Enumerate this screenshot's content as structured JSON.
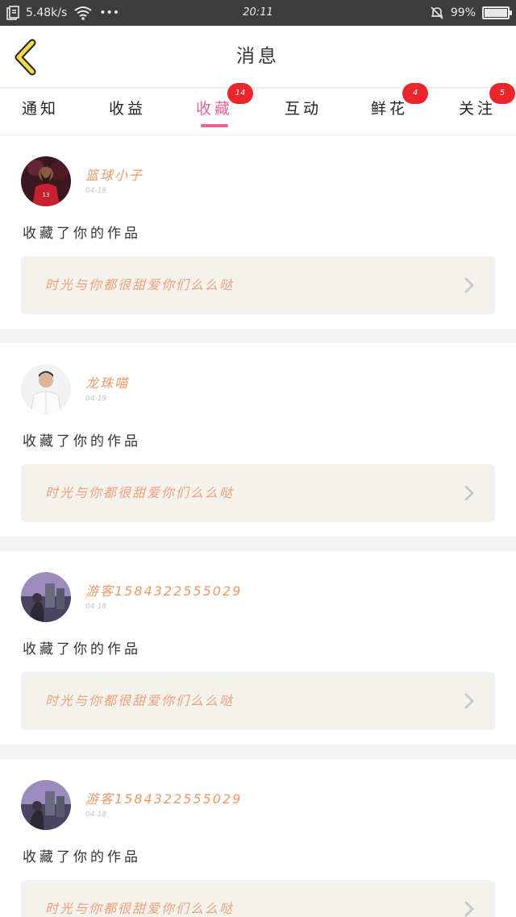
{
  "status_bar": {
    "speed": "5.48k/s",
    "more": "•••",
    "time": "20:11",
    "battery": "99%",
    "battery_level": 0.99
  },
  "nav": {
    "title": "消息"
  },
  "tabs": [
    {
      "label": "通知",
      "badge": ""
    },
    {
      "label": "收益",
      "badge": ""
    },
    {
      "label": "收藏",
      "badge": "14",
      "active": true
    },
    {
      "label": "互动",
      "badge": ""
    },
    {
      "label": "鲜花",
      "badge": "4"
    },
    {
      "label": "关注",
      "badge": "5"
    }
  ],
  "messages": [
    {
      "user": "篮球小子",
      "date": "04-19",
      "action": "收藏了你的作品",
      "work": "时光与你都很甜爱你们么么哒",
      "avatar": "avatar-basketball"
    },
    {
      "user": "龙珠喵",
      "date": "04-19",
      "action": "收藏了你的作品",
      "work": "时光与你都很甜爱你们么么哒",
      "avatar": "avatar-man-white-shirt"
    },
    {
      "user": "游客1584322555029",
      "date": "04-18",
      "action": "收藏了你的作品",
      "work": "时光与你都很甜爱你们么么哒",
      "avatar": "avatar-city-dusk"
    },
    {
      "user": "游客1584322555029",
      "date": "04-18",
      "action": "收藏了你的作品",
      "work": "时光与你都很甜爱你们么么哒",
      "avatar": "avatar-city-dusk"
    }
  ],
  "colors": {
    "accent": "#e8649a",
    "badge": "#e8262c",
    "username": "#e89a6a",
    "work_link_text": "#efa07a",
    "back_arrow": "#f2d94e"
  }
}
